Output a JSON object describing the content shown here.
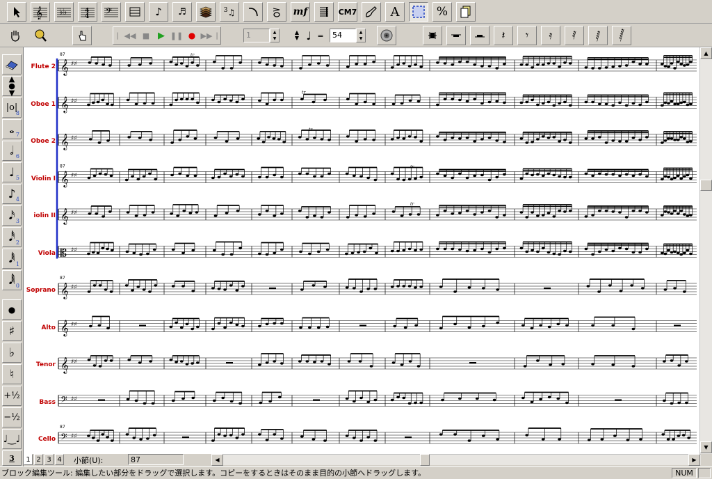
{
  "toolbar1": {
    "chord_label": "CM7",
    "dynamic_label": "mf",
    "text_tool_label": "A",
    "percent_label": "%",
    "triplet_label": "3"
  },
  "toolbar2": {
    "measure_value": "1",
    "tempo_equals": "=",
    "tempo_value": "54"
  },
  "left_toolbar": {
    "sub_labels": [
      "8",
      "7",
      "6",
      "5",
      "4",
      "3",
      "2",
      "1",
      "0"
    ],
    "plus_half": "+½",
    "minus_half": "−½",
    "triplet": "3"
  },
  "score": {
    "measure_start": "87",
    "trill": "tr",
    "parts": [
      {
        "name": "Flute 2",
        "clef": "treble"
      },
      {
        "name": "Oboe 1",
        "clef": "treble"
      },
      {
        "name": "Oboe 2",
        "clef": "treble"
      },
      {
        "name": "Violin I",
        "clef": "treble"
      },
      {
        "name": "iolin II",
        "clef": "treble"
      },
      {
        "name": "Viola",
        "clef": "alto"
      },
      {
        "name": "Soprano",
        "clef": "treble"
      },
      {
        "name": "Alto",
        "clef": "treble"
      },
      {
        "name": "Tenor",
        "clef": "treble8"
      },
      {
        "name": "Bass",
        "clef": "bass"
      },
      {
        "name": "Cello",
        "clef": "bass"
      }
    ]
  },
  "bottom": {
    "pages": [
      "1",
      "2",
      "3",
      "4"
    ],
    "measure_label": "小節(U):",
    "measure_value": "87"
  },
  "status": {
    "message": "ブロック編集ツール: 編集したい部分をドラッグで選択します。コピーをするときはそのまま目的の小節へドラッグします。",
    "num_indicator": "NUM"
  },
  "colors": {
    "toolbar_bg": "#d4d0c8",
    "part_name": "#c00000",
    "barline_blue": "#2030c8",
    "tool_highlight": "#3050c0"
  }
}
